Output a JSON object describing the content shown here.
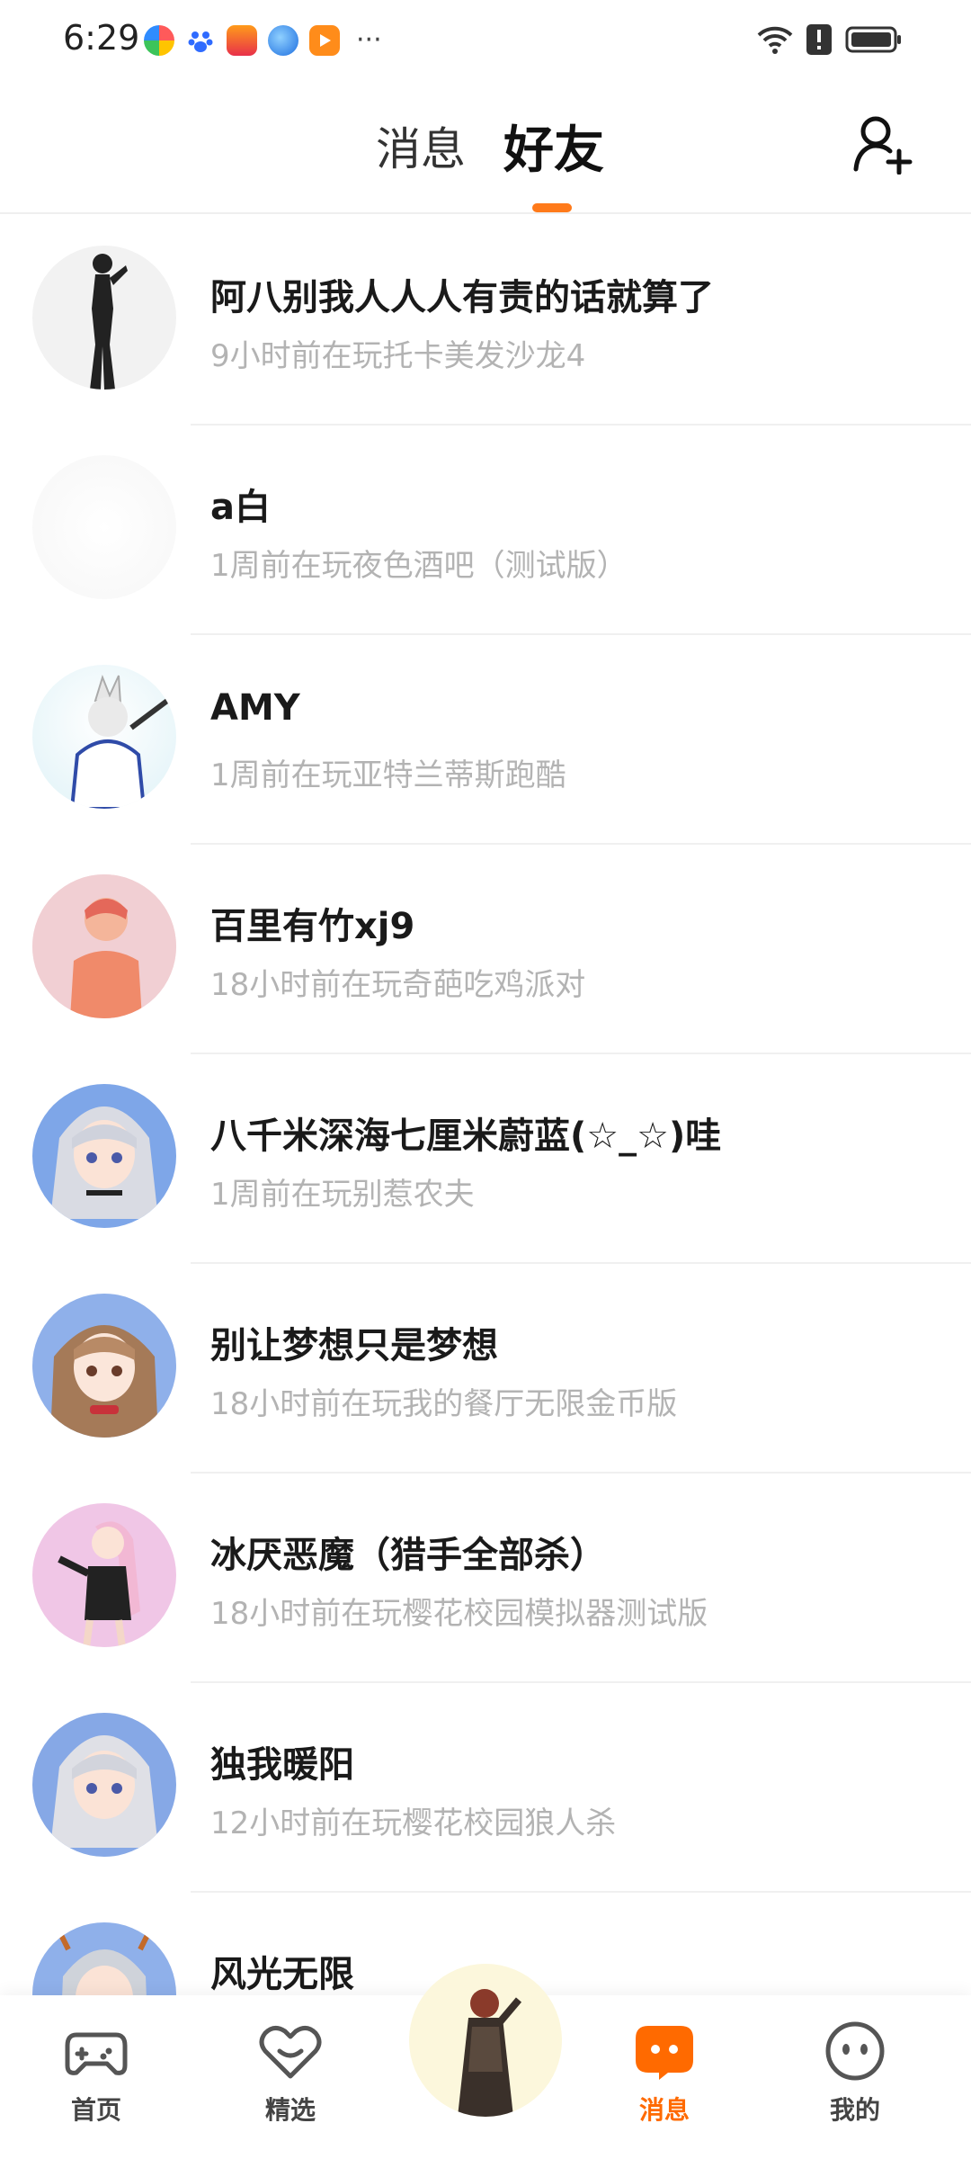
{
  "status_bar": {
    "time": "6:29",
    "more": "···"
  },
  "header": {
    "tabs": [
      {
        "label": "消息",
        "active": false
      },
      {
        "label": "好友",
        "active": true
      }
    ],
    "accent_color": "#ff7a1a"
  },
  "friends": [
    {
      "name": "阿八别我人人人有责的话就算了",
      "status": "9小时前在玩托卡美发沙龙4"
    },
    {
      "name": "a白",
      "status": "1周前在玩夜色酒吧（测试版）"
    },
    {
      "name": "AMY",
      "status": "1周前在玩亚特兰蒂斯跑酷"
    },
    {
      "name": "百里有竹xj9",
      "status": "18小时前在玩奇葩吃鸡派对"
    },
    {
      "name": "八千米深海七厘米蔚蓝(☆_☆)哇",
      "status": "1周前在玩别惹农夫"
    },
    {
      "name": "别让梦想只是梦想",
      "status": "18小时前在玩我的餐厅无限金币版"
    },
    {
      "name": "冰厌恶魔（猎手全部杀）",
      "status": "18小时前在玩樱花校园模拟器测试版"
    },
    {
      "name": "独我暖阳",
      "status": "12小时前在玩樱花校园狼人杀"
    },
    {
      "name": "风光无限",
      "status": ""
    }
  ],
  "bottom_nav": {
    "items": [
      {
        "label": "首页",
        "icon": "gamepad-icon",
        "active": false
      },
      {
        "label": "精选",
        "icon": "heart-icon",
        "active": false
      },
      {
        "label": "消息",
        "icon": "chat-icon",
        "active": true
      },
      {
        "label": "我的",
        "icon": "face-icon",
        "active": false
      }
    ]
  }
}
